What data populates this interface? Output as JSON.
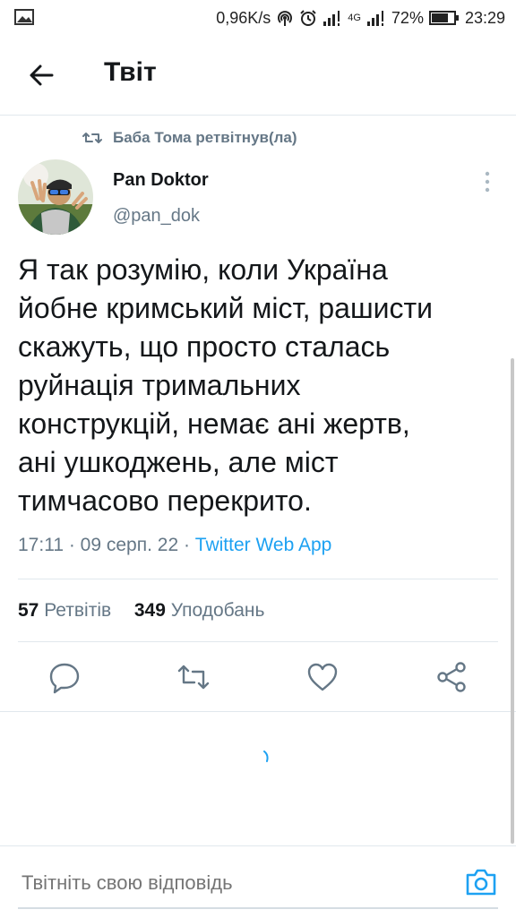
{
  "status_bar": {
    "speed": "0,96K/s",
    "network": "4G",
    "battery": "72%",
    "time": "23:29"
  },
  "header": {
    "title": "Твіт"
  },
  "tweet": {
    "retweeted_by": "Баба Тома ретвітнув(ла)",
    "author_name": "Pan Doktor",
    "author_handle": "@pan_dok",
    "text_lines": [
      "Я так розумію, коли Україна",
      "йобне кримський міст, рашисти",
      "скажуть, що просто сталась",
      "руйнація тримальних",
      "конструкцій, немає ані жертв,",
      "ані ушкоджень, але міст",
      "тимчасово перекрито."
    ],
    "time": "17:11",
    "date": "09 серп. 22",
    "app": "Twitter Web App",
    "retweets_count": "57",
    "retweets_label": "Ретвітів",
    "likes_count": "349",
    "likes_label": "Уподобань"
  },
  "reply": {
    "placeholder": "Твітніть свою відповідь"
  },
  "colors": {
    "accent": "#1da1f2",
    "secondary_text": "#657786",
    "divider": "#e1e8ed"
  },
  "icons": [
    "image-icon",
    "hotspot-icon",
    "alarm-icon",
    "signal-icon",
    "battery-icon",
    "back-arrow-icon",
    "retweet-icon",
    "more-vertical-icon",
    "reply-icon",
    "like-icon",
    "share-icon",
    "loading-spinner-icon",
    "camera-icon"
  ]
}
